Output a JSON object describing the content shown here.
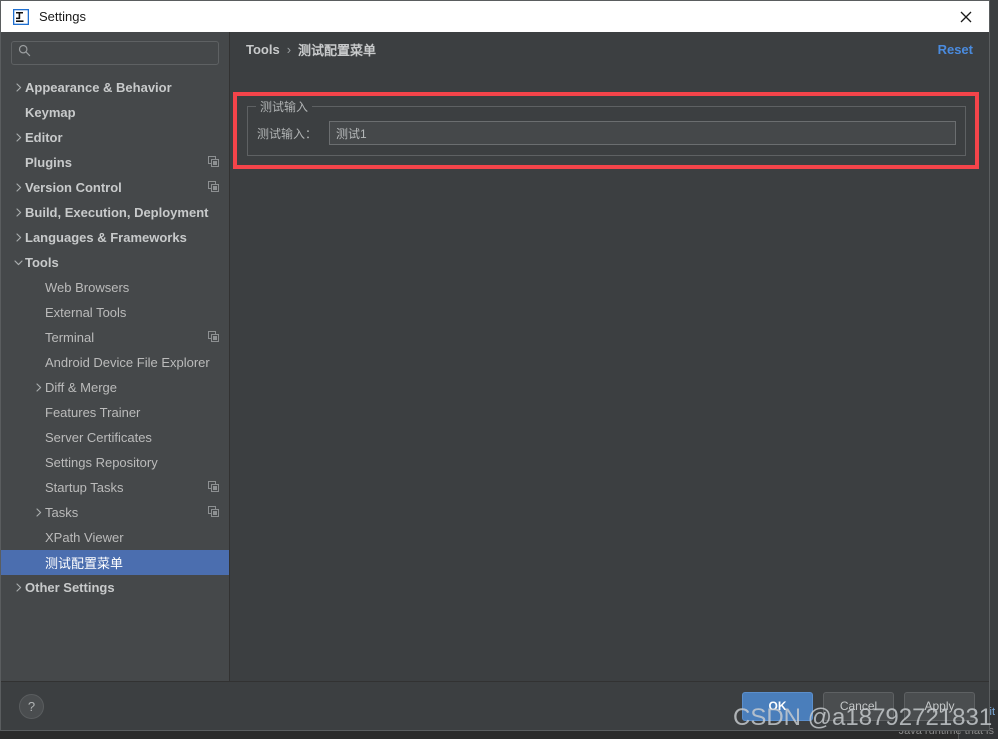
{
  "window": {
    "title": "Settings",
    "app_icon": "intellij-idea-icon",
    "close_label": "✕"
  },
  "search": {
    "value": "",
    "placeholder": "",
    "icon": "search-icon"
  },
  "sidebar": {
    "items": [
      {
        "label": "Appearance & Behavior",
        "depth": 0,
        "expandable": true,
        "expanded": false,
        "badge": false,
        "selected": false
      },
      {
        "label": "Keymap",
        "depth": 0,
        "expandable": false,
        "expanded": false,
        "badge": false,
        "selected": false
      },
      {
        "label": "Editor",
        "depth": 0,
        "expandable": true,
        "expanded": false,
        "badge": false,
        "selected": false
      },
      {
        "label": "Plugins",
        "depth": 0,
        "expandable": false,
        "expanded": false,
        "badge": true,
        "selected": false
      },
      {
        "label": "Version Control",
        "depth": 0,
        "expandable": true,
        "expanded": false,
        "badge": true,
        "selected": false
      },
      {
        "label": "Build, Execution, Deployment",
        "depth": 0,
        "expandable": true,
        "expanded": false,
        "badge": false,
        "selected": false
      },
      {
        "label": "Languages & Frameworks",
        "depth": 0,
        "expandable": true,
        "expanded": false,
        "badge": false,
        "selected": false
      },
      {
        "label": "Tools",
        "depth": 0,
        "expandable": true,
        "expanded": true,
        "badge": false,
        "selected": false
      },
      {
        "label": "Web Browsers",
        "depth": 1,
        "expandable": false,
        "expanded": false,
        "badge": false,
        "selected": false
      },
      {
        "label": "External Tools",
        "depth": 1,
        "expandable": false,
        "expanded": false,
        "badge": false,
        "selected": false
      },
      {
        "label": "Terminal",
        "depth": 1,
        "expandable": false,
        "expanded": false,
        "badge": true,
        "selected": false
      },
      {
        "label": "Android Device File Explorer",
        "depth": 1,
        "expandable": false,
        "expanded": false,
        "badge": false,
        "selected": false
      },
      {
        "label": "Diff & Merge",
        "depth": 1,
        "expandable": true,
        "expanded": false,
        "badge": false,
        "selected": false
      },
      {
        "label": "Features Trainer",
        "depth": 1,
        "expandable": false,
        "expanded": false,
        "badge": false,
        "selected": false
      },
      {
        "label": "Server Certificates",
        "depth": 1,
        "expandable": false,
        "expanded": false,
        "badge": false,
        "selected": false
      },
      {
        "label": "Settings Repository",
        "depth": 1,
        "expandable": false,
        "expanded": false,
        "badge": false,
        "selected": false
      },
      {
        "label": "Startup Tasks",
        "depth": 1,
        "expandable": false,
        "expanded": false,
        "badge": true,
        "selected": false
      },
      {
        "label": "Tasks",
        "depth": 1,
        "expandable": true,
        "expanded": false,
        "badge": true,
        "selected": false
      },
      {
        "label": "XPath Viewer",
        "depth": 1,
        "expandable": false,
        "expanded": false,
        "badge": false,
        "selected": false
      },
      {
        "label": "测试配置菜单",
        "depth": 1,
        "expandable": false,
        "expanded": false,
        "badge": false,
        "selected": true
      },
      {
        "label": "Other Settings",
        "depth": 0,
        "expandable": true,
        "expanded": false,
        "badge": false,
        "selected": false
      }
    ]
  },
  "content": {
    "breadcrumb": {
      "root": "Tools",
      "separator": "›",
      "current": "测试配置菜单"
    },
    "reset_label": "Reset",
    "group": {
      "legend": "测试输入",
      "field_label": "测试输入：",
      "field_value": "测试1",
      "field_placeholder": ""
    },
    "annotation_color": "#f4444a"
  },
  "footer": {
    "help_label": "?",
    "ok_label": "OK",
    "cancel_label": "Cancel",
    "apply_label": "Apply"
  },
  "overlay": {
    "watermark": "CSDN @a18792721831"
  },
  "background": {
    "runtime_text": "Java runtime that is",
    "side_text": "it"
  },
  "colors": {
    "selection": "#4b6eaf",
    "accent_link": "#4a8bdf",
    "primary_button": "#4a7ebb",
    "annotation": "#f4444a",
    "sidebar_bg": "#45484a",
    "panel_bg": "#3c3f41"
  }
}
